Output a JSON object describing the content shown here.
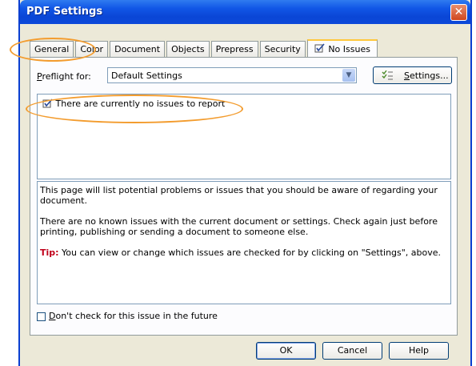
{
  "window": {
    "title": "PDF Settings",
    "close_symbol": "✕"
  },
  "tabs": [
    {
      "label": "General"
    },
    {
      "label": "Color"
    },
    {
      "label": "Document"
    },
    {
      "label": "Objects"
    },
    {
      "label": "Prepress"
    },
    {
      "label": "Security"
    },
    {
      "label": "No Issues",
      "icon": "check-document-icon",
      "active": true
    }
  ],
  "preflight": {
    "label_prefix": "P",
    "label_rest": "reflight for:",
    "selected": "Default Settings",
    "settings_button_prefix": "S",
    "settings_button_rest": "ettings..."
  },
  "issues": {
    "items": [
      "There are currently no issues to report"
    ]
  },
  "description": {
    "para1": "This page will list potential problems or issues that you should be aware of regarding your document.",
    "para2": "There are no known issues with the current document or settings. Check again just before printing, publishing or sending a document to someone else.",
    "tip_label": "Tip:",
    "tip_text": " You can view or change which issues are checked for by clicking on \"Settings\", above."
  },
  "dont_check": {
    "prefix": "D",
    "rest": "on't check for this issue in the future",
    "checked": false
  },
  "buttons": {
    "ok": "OK",
    "cancel": "Cancel",
    "help": "Help"
  },
  "colors": {
    "titlebar": "#0a46d6",
    "highlight_oval": "#f39c2e",
    "tip": "#c0001a",
    "active_tab_accent": "#ffc83c"
  }
}
